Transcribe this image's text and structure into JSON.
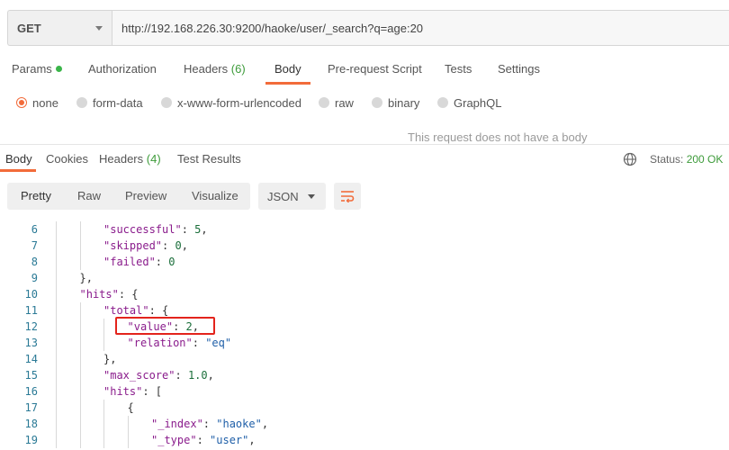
{
  "request": {
    "method": "GET",
    "url": "http://192.168.226.30:9200/haoke/user/_search?q=age:20"
  },
  "request_tabs": [
    {
      "label": "Params",
      "indicator": "green-dot"
    },
    {
      "label": "Authorization"
    },
    {
      "label": "Headers",
      "count": "(6)"
    },
    {
      "label": "Body",
      "active": true
    },
    {
      "label": "Pre-request Script"
    },
    {
      "label": "Tests"
    },
    {
      "label": "Settings"
    }
  ],
  "body_types": [
    {
      "label": "none",
      "selected": true
    },
    {
      "label": "form-data"
    },
    {
      "label": "x-www-form-urlencoded"
    },
    {
      "label": "raw"
    },
    {
      "label": "binary"
    },
    {
      "label": "GraphQL"
    }
  ],
  "no_body_message": "This request does not have a body",
  "response_tabs": [
    {
      "label": "Body",
      "active": true
    },
    {
      "label": "Cookies"
    },
    {
      "label": "Headers",
      "count": "(4)"
    },
    {
      "label": "Test Results"
    }
  ],
  "status": {
    "label": "Status:",
    "value": "200 OK"
  },
  "icons": {
    "globe": "globe-icon",
    "wrap": "wrap-lines-icon",
    "method_caret": "chevron-down-icon"
  },
  "colors": {
    "accent": "#f26b3a",
    "success": "#3d9b3a",
    "key": "#8a1c8c",
    "string": "#1f5fa8",
    "number": "#1a6e3a",
    "line_number": "#2b7a96",
    "highlight_box": "#e3241c"
  },
  "view_modes": [
    "Pretty",
    "Raw",
    "Preview",
    "Visualize"
  ],
  "format": "JSON",
  "response": {
    "lines": [
      {
        "n": "6",
        "indent": 2,
        "tokens": [
          {
            "t": "key",
            "v": "\"successful\""
          },
          {
            "t": "p",
            "v": ": "
          },
          {
            "t": "num",
            "v": "5"
          },
          {
            "t": "p",
            "v": ","
          }
        ]
      },
      {
        "n": "7",
        "indent": 2,
        "tokens": [
          {
            "t": "key",
            "v": "\"skipped\""
          },
          {
            "t": "p",
            "v": ": "
          },
          {
            "t": "num",
            "v": "0"
          },
          {
            "t": "p",
            "v": ","
          }
        ]
      },
      {
        "n": "8",
        "indent": 2,
        "tokens": [
          {
            "t": "key",
            "v": "\"failed\""
          },
          {
            "t": "p",
            "v": ": "
          },
          {
            "t": "num",
            "v": "0"
          }
        ]
      },
      {
        "n": "9",
        "indent": 1,
        "tokens": [
          {
            "t": "p",
            "v": "},"
          }
        ]
      },
      {
        "n": "10",
        "indent": 1,
        "tokens": [
          {
            "t": "key",
            "v": "\"hits\""
          },
          {
            "t": "p",
            "v": ": {"
          }
        ]
      },
      {
        "n": "11",
        "indent": 2,
        "tokens": [
          {
            "t": "key",
            "v": "\"total\""
          },
          {
            "t": "p",
            "v": ": {"
          }
        ]
      },
      {
        "n": "12",
        "indent": 3,
        "tokens": [
          {
            "t": "key",
            "v": "\"value\""
          },
          {
            "t": "p",
            "v": ": "
          },
          {
            "t": "num",
            "v": "2"
          },
          {
            "t": "p",
            "v": ","
          }
        ]
      },
      {
        "n": "13",
        "indent": 3,
        "tokens": [
          {
            "t": "key",
            "v": "\"relation\""
          },
          {
            "t": "p",
            "v": ": "
          },
          {
            "t": "str",
            "v": "\"eq\""
          }
        ]
      },
      {
        "n": "14",
        "indent": 2,
        "tokens": [
          {
            "t": "p",
            "v": "},"
          }
        ]
      },
      {
        "n": "15",
        "indent": 2,
        "tokens": [
          {
            "t": "key",
            "v": "\"max_score\""
          },
          {
            "t": "p",
            "v": ": "
          },
          {
            "t": "num",
            "v": "1.0"
          },
          {
            "t": "p",
            "v": ","
          }
        ]
      },
      {
        "n": "16",
        "indent": 2,
        "tokens": [
          {
            "t": "key",
            "v": "\"hits\""
          },
          {
            "t": "p",
            "v": ": ["
          }
        ]
      },
      {
        "n": "17",
        "indent": 3,
        "tokens": [
          {
            "t": "p",
            "v": "{"
          }
        ]
      },
      {
        "n": "18",
        "indent": 4,
        "tokens": [
          {
            "t": "key",
            "v": "\"_index\""
          },
          {
            "t": "p",
            "v": ": "
          },
          {
            "t": "str",
            "v": "\"haoke\""
          },
          {
            "t": "p",
            "v": ","
          }
        ]
      },
      {
        "n": "19",
        "indent": 4,
        "tokens": [
          {
            "t": "key",
            "v": "\"_type\""
          },
          {
            "t": "p",
            "v": ": "
          },
          {
            "t": "str",
            "v": "\"user\""
          },
          {
            "t": "p",
            "v": ","
          }
        ]
      }
    ]
  }
}
